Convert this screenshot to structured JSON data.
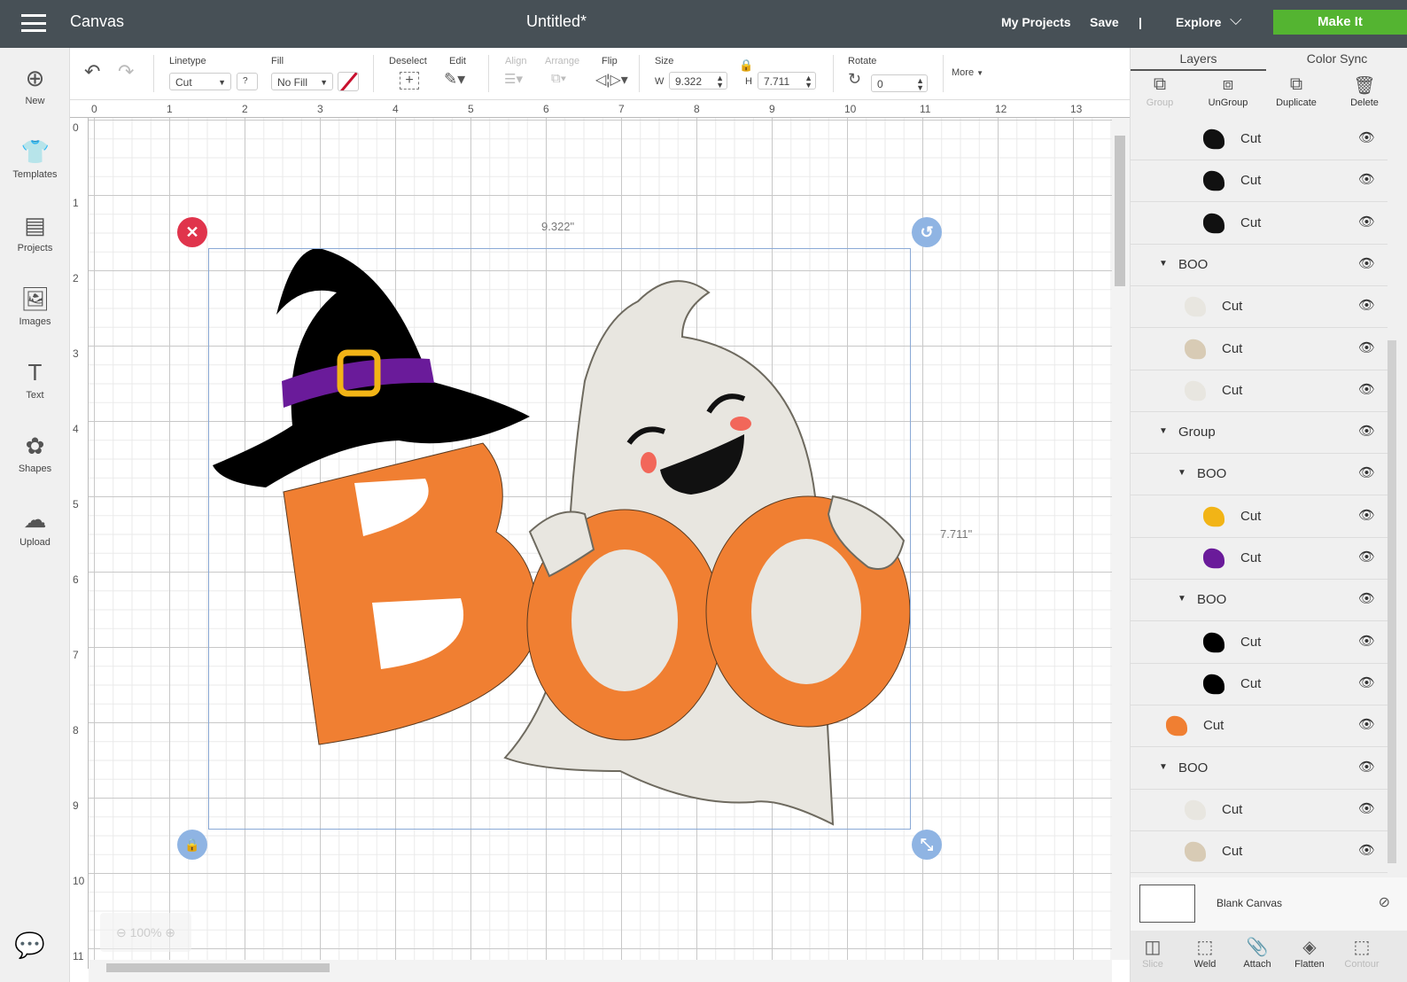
{
  "topbar": {
    "app": "Canvas",
    "title": "Untitled*",
    "my_projects": "My Projects",
    "save": "Save",
    "sep": "|",
    "explore": "Explore",
    "make_it": "Make It"
  },
  "sidebar": [
    {
      "label": "New",
      "icon": "plus-circle-icon",
      "glyph": "⊕"
    },
    {
      "label": "Templates",
      "icon": "tshirt-icon",
      "glyph": "👕"
    },
    {
      "label": "Projects",
      "icon": "projects-icon",
      "glyph": "▤"
    },
    {
      "label": "Images",
      "icon": "image-icon",
      "glyph": "🖼"
    },
    {
      "label": "Text",
      "icon": "text-icon",
      "glyph": "T"
    },
    {
      "label": "Shapes",
      "icon": "shapes-icon",
      "glyph": "✿"
    },
    {
      "label": "Upload",
      "icon": "upload-cloud-icon",
      "glyph": "☁"
    }
  ],
  "toolbar": {
    "linetype_label": "Linetype",
    "linetype_value": "Cut",
    "help": "?",
    "fill_label": "Fill",
    "fill_value": "No Fill",
    "deselect": "Deselect",
    "edit": "Edit",
    "align": "Align",
    "arrange": "Arrange",
    "flip": "Flip",
    "size": "Size",
    "w": "W",
    "w_value": "9.322",
    "h": "H",
    "h_value": "7.711",
    "rotate": "Rotate",
    "rotate_value": "0",
    "more": "More"
  },
  "ruler": {
    "h": [
      "0",
      "1",
      "2",
      "3",
      "4",
      "5",
      "6",
      "7",
      "8",
      "9",
      "10",
      "11",
      "12",
      "13"
    ],
    "v": [
      "0",
      "1",
      "2",
      "3",
      "4",
      "5",
      "6",
      "7",
      "8",
      "9",
      "10",
      "11"
    ]
  },
  "canvas": {
    "width_label": "9.322\"",
    "height_label": "7.711\"",
    "zoom": "100%"
  },
  "panel": {
    "tabs": [
      "Layers",
      "Color Sync"
    ],
    "actions": [
      {
        "label": "Group",
        "disabled": true,
        "glyph": "⧉"
      },
      {
        "label": "UnGroup",
        "disabled": false,
        "glyph": "⧈"
      },
      {
        "label": "Duplicate",
        "disabled": false,
        "glyph": "⧉"
      },
      {
        "label": "Delete",
        "disabled": false,
        "glyph": "🗑"
      }
    ],
    "layers": [
      {
        "kind": "layer",
        "label": "Cut",
        "indent": 2,
        "color": "#111111"
      },
      {
        "kind": "layer",
        "label": "Cut",
        "indent": 2,
        "color": "#111111"
      },
      {
        "kind": "layer",
        "label": "Cut",
        "indent": 2,
        "color": "#111111"
      },
      {
        "kind": "group",
        "label": "BOO",
        "indent": 0
      },
      {
        "kind": "layer",
        "label": "Cut",
        "indent": 1,
        "color": "#e8e6e0"
      },
      {
        "kind": "layer",
        "label": "Cut",
        "indent": 1,
        "color": "#d8cbb5"
      },
      {
        "kind": "layer",
        "label": "Cut",
        "indent": 1,
        "color": "#e8e6e0"
      },
      {
        "kind": "group",
        "label": "Group",
        "indent": 0
      },
      {
        "kind": "group",
        "label": "BOO",
        "indent": 1
      },
      {
        "kind": "layer",
        "label": "Cut",
        "indent": 2,
        "color": "#f2b416"
      },
      {
        "kind": "layer",
        "label": "Cut",
        "indent": 2,
        "color": "#6a1b9a"
      },
      {
        "kind": "group",
        "label": "BOO",
        "indent": 1
      },
      {
        "kind": "layer",
        "label": "Cut",
        "indent": 2,
        "color": "#000000"
      },
      {
        "kind": "layer",
        "label": "Cut",
        "indent": 2,
        "color": "#000000"
      },
      {
        "kind": "layer",
        "label": "Cut",
        "indent": 0,
        "color": "#f07f32"
      },
      {
        "kind": "group",
        "label": "BOO",
        "indent": 0
      },
      {
        "kind": "layer",
        "label": "Cut",
        "indent": 1,
        "color": "#e8e6e0"
      },
      {
        "kind": "layer",
        "label": "Cut",
        "indent": 1,
        "color": "#d8cbb5"
      }
    ],
    "blank_canvas": "Blank Canvas",
    "bottom": [
      {
        "label": "Slice",
        "disabled": true,
        "glyph": "◫"
      },
      {
        "label": "Weld",
        "disabled": false,
        "glyph": "⬚"
      },
      {
        "label": "Attach",
        "disabled": false,
        "glyph": "📎"
      },
      {
        "label": "Flatten",
        "disabled": false,
        "glyph": "◈"
      },
      {
        "label": "Contour",
        "disabled": true,
        "glyph": "⬚"
      }
    ]
  },
  "colors": {
    "topbar": "#475056",
    "make_it": "#54b431",
    "boo_orange": "#f07f32",
    "hat_band": "#6a1b9a",
    "buckle": "#f2b416",
    "ghost": "#e8e6e0"
  }
}
